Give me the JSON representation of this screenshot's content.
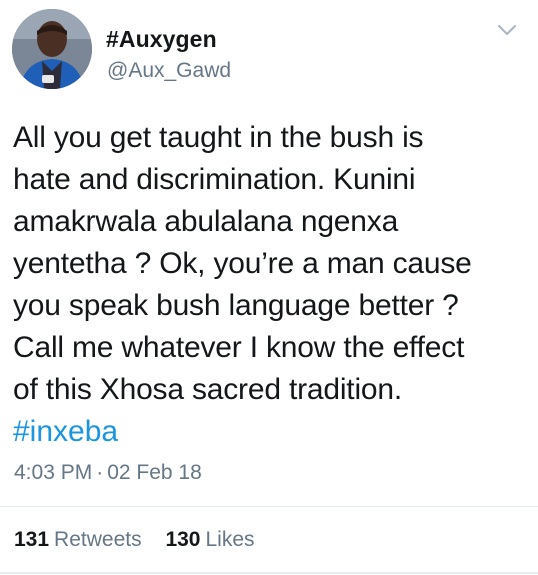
{
  "user": {
    "display_name": "#Auxygen",
    "handle": "@Aux_Gawd"
  },
  "tweet": {
    "text": "All you get taught in the bush is\nhate and discrimination. Kunini\namakrwala abulalana ngenxa\nyentetha ? Ok, you’re a man cause\nyou speak bush language better ?\nCall me whatever I know the effect\nof this Xhosa sacred tradition.",
    "hashtag": "#inxeba",
    "time": "4:03 PM",
    "separator": "·",
    "date": "02 Feb 18"
  },
  "stats": {
    "retweets_count": "131",
    "retweets_label": "Retweets",
    "likes_count": "130",
    "likes_label": "Likes"
  },
  "icons": {
    "menu": "chevron-down-icon",
    "avatar": "avatar"
  },
  "colors": {
    "link": "#1b95e0",
    "secondary_text": "#657786",
    "primary_text": "#14171a",
    "divider": "#e6ecf0"
  }
}
